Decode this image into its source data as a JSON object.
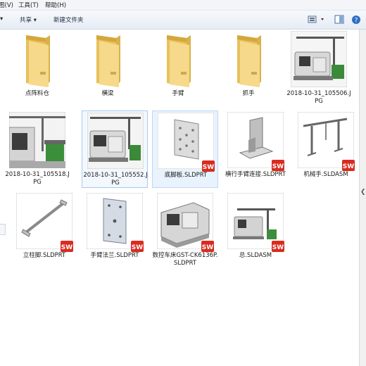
{
  "menubar": {
    "view": "图(V)",
    "tools": "工具(T)",
    "help": "帮助(H)"
  },
  "toolbar": {
    "share": "共享 ▾",
    "new_folder": "新建文件夹"
  },
  "items": [
    {
      "label": "点阵料仓",
      "type": "folder"
    },
    {
      "label": "横梁",
      "type": "folder"
    },
    {
      "label": "手臂",
      "type": "folder"
    },
    {
      "label": "抓手",
      "type": "folder"
    },
    {
      "label": "2018-10-31_105506.JPG",
      "type": "photo"
    },
    {
      "label": "2018-10-31_105518.JPG",
      "type": "photo"
    },
    {
      "label": "2018-10-31_105552.JPG",
      "type": "photo"
    },
    {
      "label": "底脚板.SLDPRT",
      "type": "sldprt"
    },
    {
      "label": "横行手臂连接.SLDPRT",
      "type": "sldprt"
    },
    {
      "label": "机械手.SLDASM",
      "type": "sldasm"
    },
    {
      "label": "立柱脚.SLDPRT",
      "type": "sldprt"
    },
    {
      "label": "手臂法兰.SLDPRT",
      "type": "sldprt"
    },
    {
      "label": "数控车床GST-CK6136P.SLDPRT",
      "type": "sldprt"
    },
    {
      "label": "总.SLDASM",
      "type": "sldasm"
    }
  ]
}
